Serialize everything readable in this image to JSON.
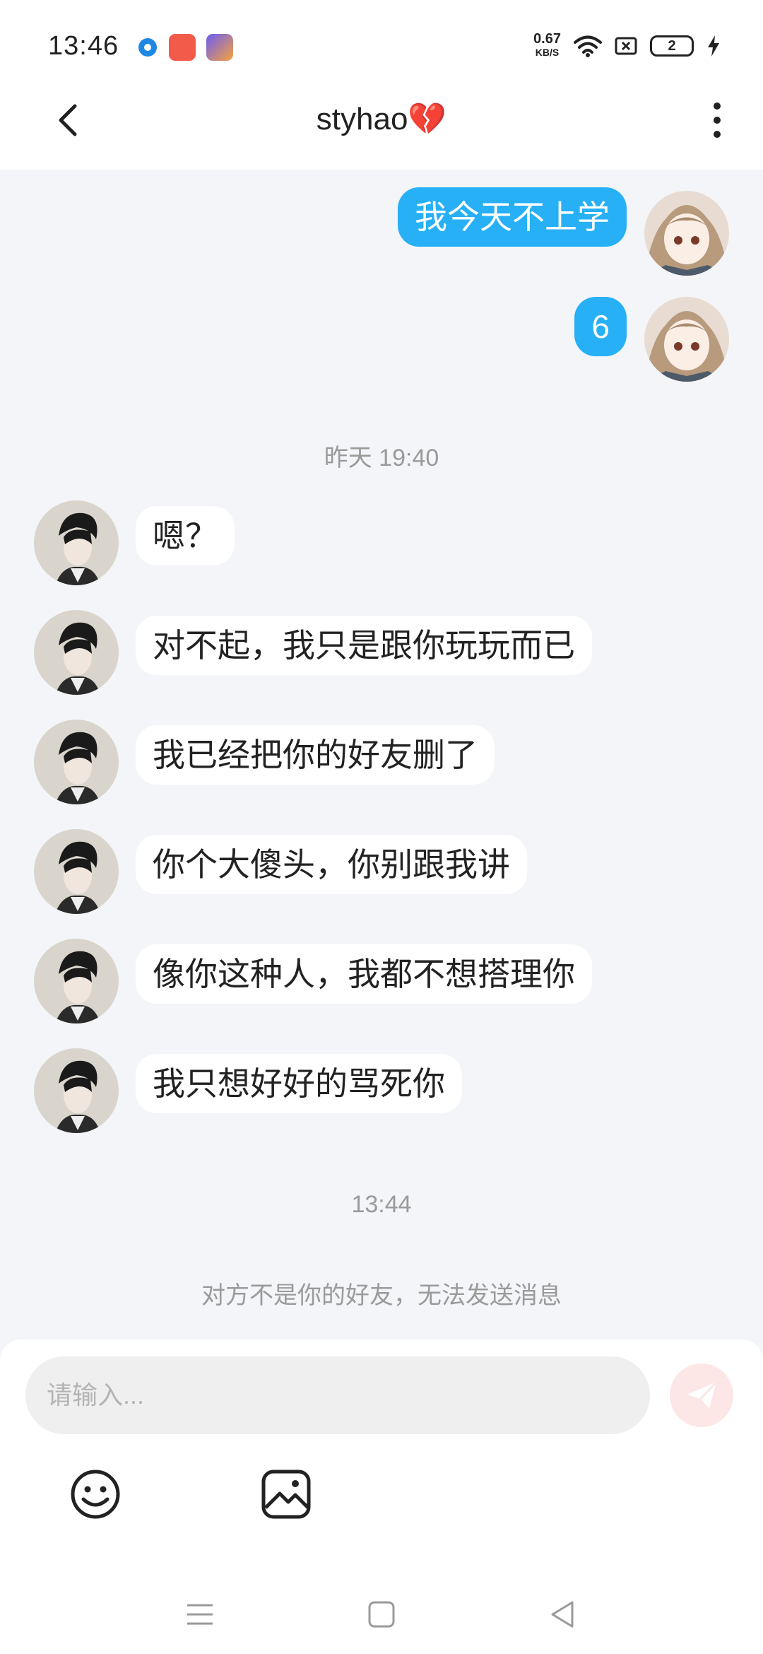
{
  "status_bar": {
    "time": "13:46",
    "net_speed_value": "0.67",
    "net_speed_unit": "KB/S",
    "battery_level": "2"
  },
  "header": {
    "title": "styhao",
    "title_emoji": "💔"
  },
  "messages": [
    {
      "side": "out",
      "text": "我今天不上学"
    },
    {
      "side": "out",
      "text": "6"
    },
    {
      "side": "in",
      "text": "嗯？"
    },
    {
      "side": "in",
      "text": "对不起，我只是跟你玩玩而已"
    },
    {
      "side": "in",
      "text": "我已经把你的好友删了"
    },
    {
      "side": "in",
      "text": "你个大傻头，你别跟我讲"
    },
    {
      "side": "in",
      "text": "像你这种人，我都不想搭理你"
    },
    {
      "side": "in",
      "text": "我只想好好的骂死你"
    }
  ],
  "timestamps": {
    "yesterday": "昨天 19:40",
    "today": "13:44"
  },
  "notice": "对方不是你的好友，无法发送消息",
  "input": {
    "placeholder": "请输入..."
  },
  "toolbar": {
    "emoji_icon": "emoji-icon",
    "image_icon": "image-icon"
  },
  "colors": {
    "accent_bubble": "#27b0f6",
    "send_button_disabled": "#fde6e6"
  }
}
